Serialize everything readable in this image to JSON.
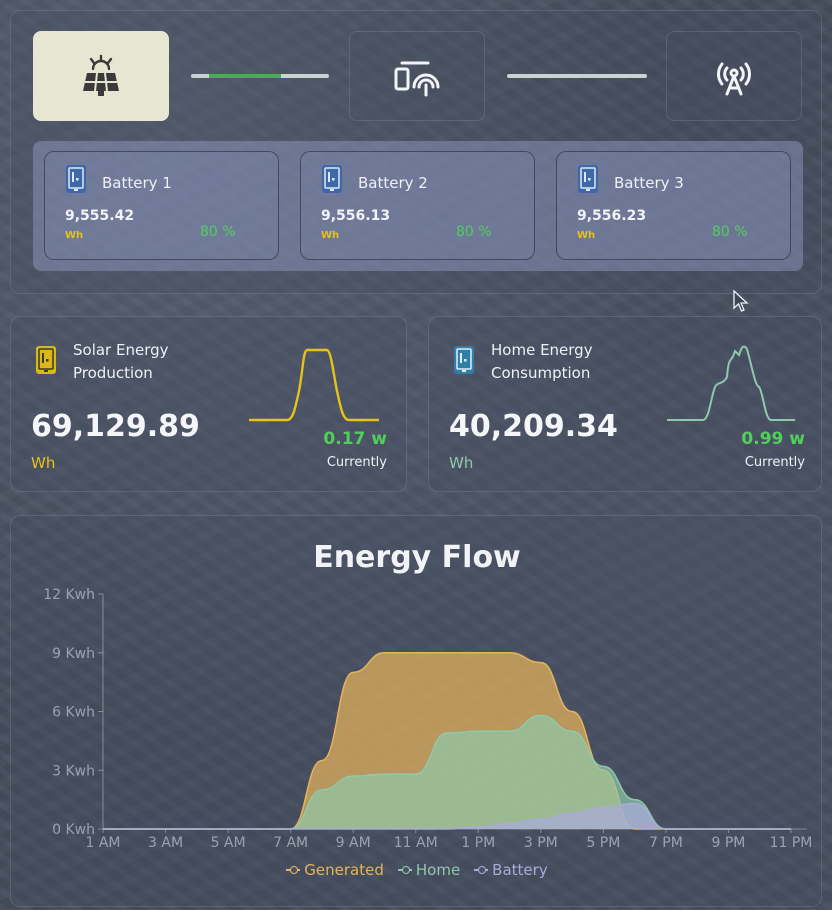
{
  "top": {
    "nodes": [
      {
        "name": "solar-panel-icon",
        "active": true
      },
      {
        "name": "inverter-icon",
        "active": false
      },
      {
        "name": "antenna-icon",
        "active": false
      }
    ],
    "connector_progress": 0.6,
    "batteries": [
      {
        "name": "Battery 1",
        "value": "9,555.42",
        "unit": "Wh",
        "percent": "80 %"
      },
      {
        "name": "Battery 2",
        "value": "9,556.13",
        "unit": "Wh",
        "percent": "80 %"
      },
      {
        "name": "Battery 3",
        "value": "9,556.23",
        "unit": "Wh",
        "percent": "80 %"
      }
    ]
  },
  "solar": {
    "title": "Solar Energy Production",
    "value": "69,129.89",
    "unit": "Wh",
    "current": "0.17 w",
    "current_label": "Currently",
    "color": "#e6c21c"
  },
  "home": {
    "title": "Home Energy Consumption",
    "value": "40,209.34",
    "unit": "Wh",
    "current": "0.99 w",
    "current_label": "Currently",
    "color": "#8fc9aa"
  },
  "flow": {
    "title": "Energy Flow"
  },
  "chart_data": {
    "type": "area",
    "title": "Energy Flow",
    "x": [
      "1 AM",
      "2 AM",
      "3 AM",
      "4 AM",
      "5 AM",
      "6 AM",
      "7 AM",
      "8 AM",
      "9 AM",
      "10 AM",
      "11 AM",
      "12 PM",
      "1 PM",
      "2 PM",
      "3 PM",
      "4 PM",
      "5 PM",
      "6 PM",
      "7 PM",
      "8 PM",
      "9 PM",
      "10 PM",
      "11 PM"
    ],
    "xticks": [
      "1 AM",
      "3 AM",
      "5 AM",
      "7 AM",
      "9 AM",
      "11 AM",
      "1 PM",
      "3 PM",
      "5 PM",
      "7 PM",
      "9 PM",
      "11 PM"
    ],
    "ylim": [
      0,
      12
    ],
    "yticks": [
      "0 Kwh",
      "3 Kwh",
      "6 Kwh",
      "9 Kwh",
      "12 Kwh"
    ],
    "series": [
      {
        "name": "Generated",
        "color": "#e6b35c",
        "values": [
          0,
          0,
          0,
          0,
          0,
          0,
          0,
          3.5,
          8,
          9,
          9,
          9,
          9,
          9,
          8.5,
          6,
          3,
          0,
          0,
          0,
          0,
          0,
          0
        ]
      },
      {
        "name": "Home",
        "color": "#8fc9aa",
        "values": [
          0,
          0,
          0,
          0,
          0,
          0,
          0,
          2,
          2.7,
          2.8,
          2.8,
          4.9,
          5,
          5,
          5.8,
          5,
          3.2,
          1.5,
          0,
          0,
          0,
          0,
          0
        ]
      },
      {
        "name": "Battery",
        "color": "#a8acd8",
        "values": [
          0,
          0,
          0,
          0,
          0,
          0,
          0,
          0,
          0,
          0,
          0,
          0,
          0.1,
          0.3,
          0.5,
          0.8,
          1.1,
          1.3,
          0,
          0,
          0,
          0,
          0
        ]
      }
    ],
    "legend": "bottom"
  }
}
